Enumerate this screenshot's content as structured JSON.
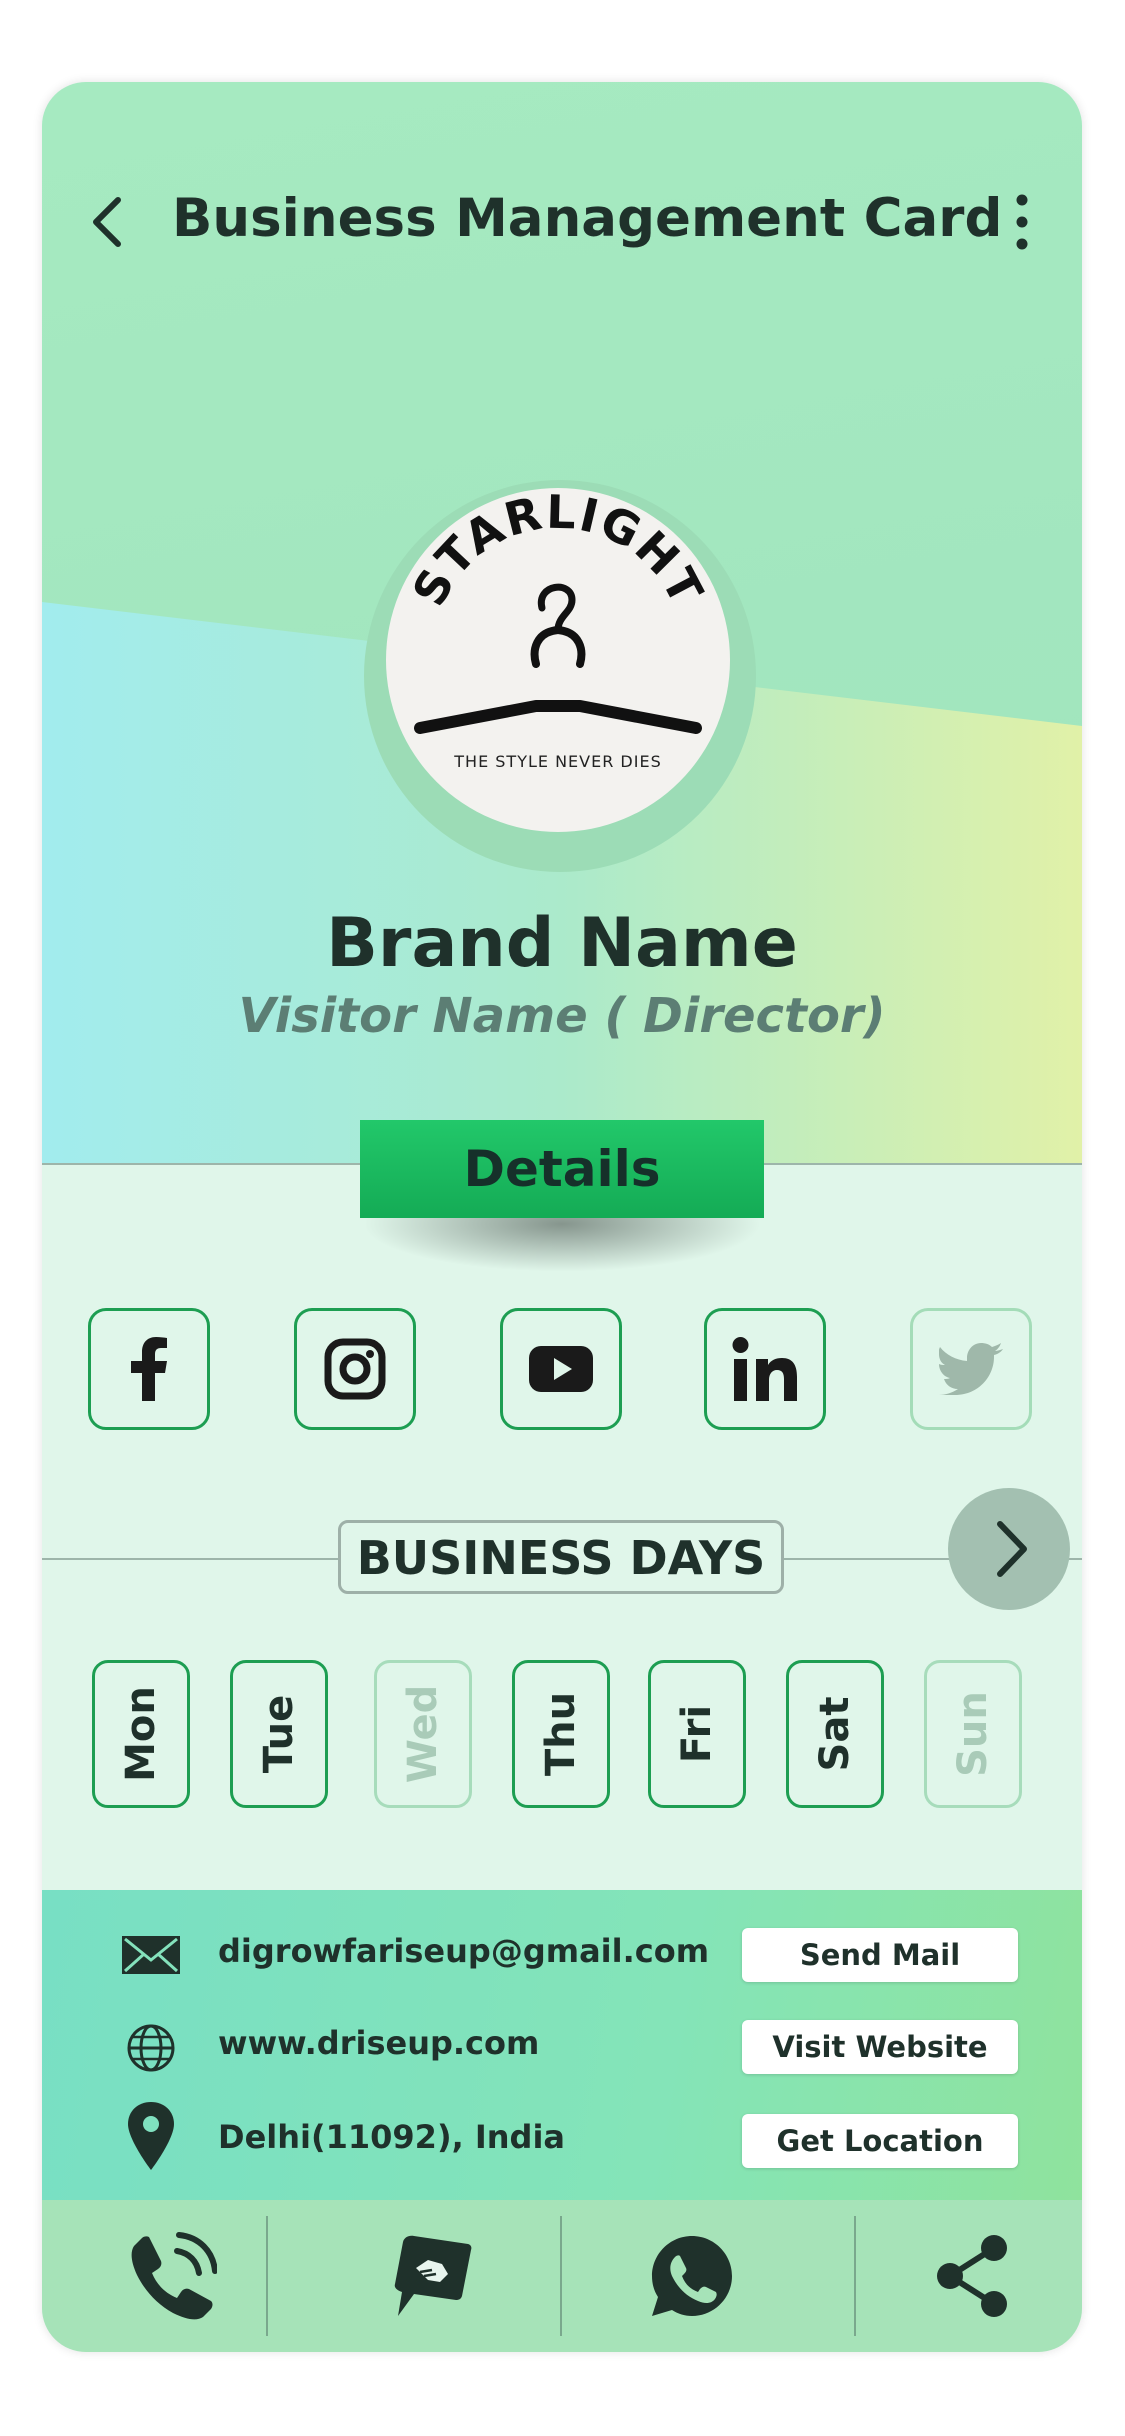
{
  "header": {
    "title": "Business Management Card",
    "back_icon": "chevron-left-icon",
    "menu_icon": "more-vertical-icon"
  },
  "logo": {
    "brand_text": "STARLIGHT",
    "tagline": "THE STYLE NEVER DIES",
    "icon": "hanger-icon"
  },
  "profile": {
    "brand_name": "Brand Name",
    "visitor_name": "Visitor Name ( Director)"
  },
  "details": {
    "label": "Details"
  },
  "social": [
    {
      "name": "facebook-icon",
      "enabled": true
    },
    {
      "name": "instagram-icon",
      "enabled": true
    },
    {
      "name": "youtube-icon",
      "enabled": true
    },
    {
      "name": "linkedin-icon",
      "enabled": true
    },
    {
      "name": "twitter-icon",
      "enabled": false
    }
  ],
  "business_days": {
    "label": "BUSINESS DAYS",
    "next_icon": "chevron-right-icon",
    "days": [
      {
        "label": "Mon",
        "open": true
      },
      {
        "label": "Tue",
        "open": true
      },
      {
        "label": "Wed",
        "open": false
      },
      {
        "label": "Thu",
        "open": true
      },
      {
        "label": "Fri",
        "open": true
      },
      {
        "label": "Sat",
        "open": true
      },
      {
        "label": "Sun",
        "open": false
      }
    ]
  },
  "contact": {
    "email": {
      "text": "digrowfariseup@gmail.com",
      "button": "Send Mail",
      "icon": "mail-icon"
    },
    "website": {
      "text": "www.driseup.com",
      "button": "Visit Website",
      "icon": "globe-icon"
    },
    "location": {
      "text": "Delhi(11092), India",
      "button": "Get Location",
      "icon": "location-pin-icon"
    }
  },
  "bottom_nav": [
    {
      "icon": "phone-call-icon"
    },
    {
      "icon": "handshake-icon"
    },
    {
      "icon": "whatsapp-icon"
    },
    {
      "icon": "share-icon"
    }
  ],
  "colors": {
    "accent_green": "#1d9e52",
    "details_green": "#14ab55",
    "hero_bg": "#a6eac1",
    "body_bg": "#e0f6ea"
  }
}
